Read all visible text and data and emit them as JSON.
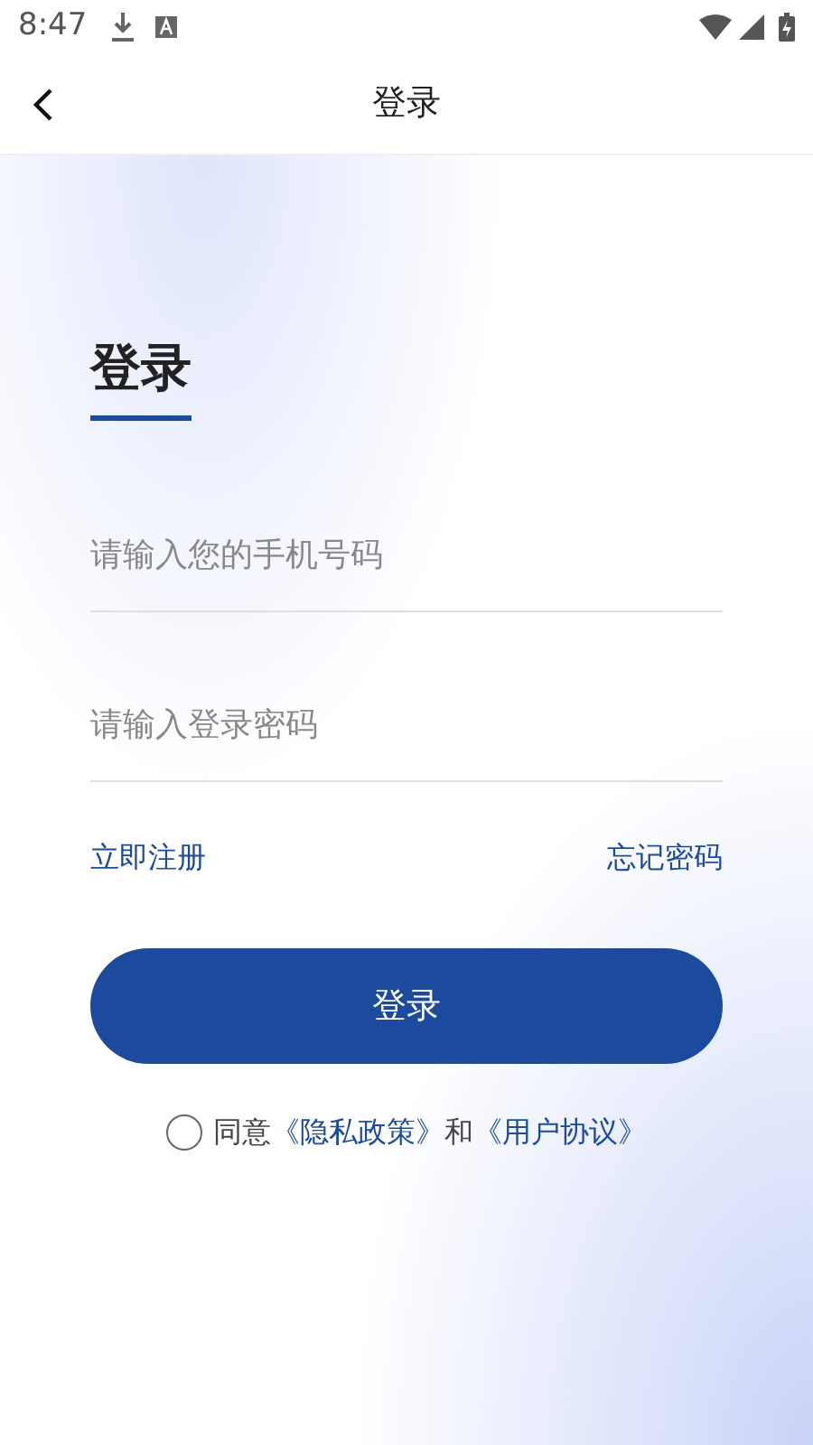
{
  "status_bar": {
    "time": "8:47"
  },
  "header": {
    "title": "登录"
  },
  "form": {
    "heading": "登录",
    "fields": [
      {
        "placeholder": "请输入您的手机号码"
      },
      {
        "placeholder": "请输入登录密码"
      }
    ],
    "register_link": "立即注册",
    "forgot_link": "忘记密码",
    "submit": "登录"
  },
  "agreement": {
    "checked": false,
    "text": "同意",
    "privacy_link": "《隐私政策》",
    "and": "和",
    "terms_link": "《用户协议》"
  }
}
